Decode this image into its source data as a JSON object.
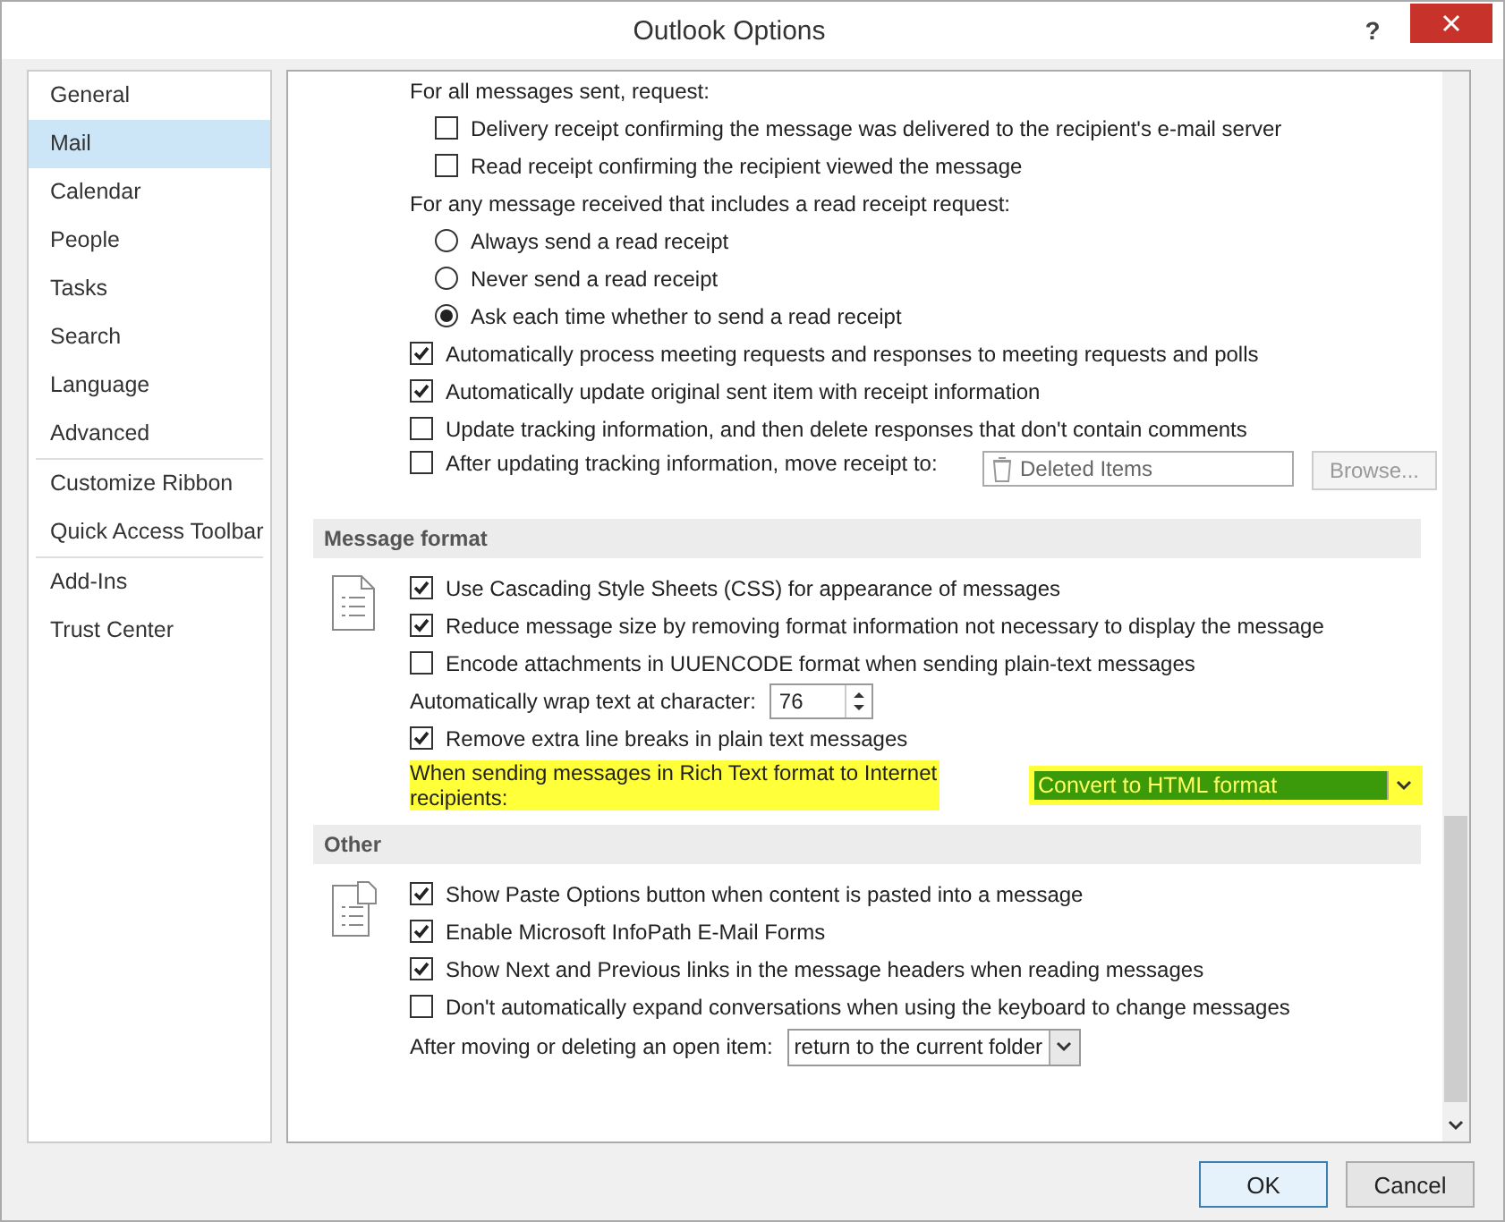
{
  "window": {
    "title": "Outlook Options",
    "help": "?"
  },
  "sidebar": {
    "groups": [
      {
        "items": [
          {
            "label": "General",
            "selected": false
          },
          {
            "label": "Mail",
            "selected": true
          },
          {
            "label": "Calendar",
            "selected": false
          },
          {
            "label": "People",
            "selected": false
          },
          {
            "label": "Tasks",
            "selected": false
          },
          {
            "label": "Search",
            "selected": false
          },
          {
            "label": "Language",
            "selected": false
          },
          {
            "label": "Advanced",
            "selected": false
          }
        ]
      },
      {
        "items": [
          {
            "label": "Customize Ribbon",
            "selected": false
          },
          {
            "label": "Quick Access Toolbar",
            "selected": false
          }
        ]
      },
      {
        "items": [
          {
            "label": "Add-Ins",
            "selected": false
          },
          {
            "label": "Trust Center",
            "selected": false
          }
        ]
      }
    ]
  },
  "sections": [
    {
      "rows": [
        {
          "kind": "label",
          "text": "For all messages sent, request:",
          "children": [
            {
              "kind": "checkbox",
              "text": "Delivery receipt confirming the message was delivered to the recipient's e-mail server",
              "checked": false
            },
            {
              "kind": "checkbox",
              "text": "Read receipt confirming the recipient viewed the message",
              "checked": false
            }
          ]
        },
        {
          "kind": "label",
          "text": "For any message received that includes a read receipt request:",
          "children": [
            {
              "kind": "radio",
              "text": "Always send a read receipt",
              "selected": false
            },
            {
              "kind": "radio",
              "text": "Never send a read receipt",
              "selected": false
            },
            {
              "kind": "radio",
              "text": "Ask each time whether to send a read receipt",
              "selected": true
            }
          ]
        },
        {
          "kind": "checkbox",
          "text": "Automatically process meeting requests and responses to meeting requests and polls",
          "checked": true
        },
        {
          "kind": "checkbox",
          "text": "Automatically update original sent item with receipt information",
          "checked": true
        },
        {
          "kind": "checkbox",
          "text": "Update tracking information, and then delete responses that don't contain comments",
          "checked": false
        },
        {
          "kind": "folder",
          "text": "After updating tracking information, move receipt to:",
          "checked": false,
          "folder": "Deleted Items",
          "button": "Browse...",
          "disabled": true
        }
      ]
    },
    {
      "title": "Message format",
      "rows": [
        {
          "kind": "checkbox",
          "text": "Use Cascading Style Sheets (CSS) for appearance of messages",
          "checked": true
        },
        {
          "kind": "checkbox",
          "text": "Reduce message size by removing format information not necessary to display the message",
          "checked": true
        },
        {
          "kind": "checkbox",
          "text": "Encode attachments in UUENCODE format when sending plain-text messages",
          "checked": false
        },
        {
          "kind": "spinner",
          "text": "Automatically wrap text at character:",
          "value": "76"
        },
        {
          "kind": "checkbox",
          "text": "Remove extra line breaks in plain text messages",
          "checked": true
        },
        {
          "kind": "dropdown",
          "text": "When sending messages in Rich Text format to Internet recipients:",
          "value": "Convert to HTML format",
          "highlighted": true
        }
      ]
    },
    {
      "title": "Other",
      "rows": [
        {
          "kind": "checkbox",
          "text": "Show Paste Options button when content is pasted into a message",
          "checked": true
        },
        {
          "kind": "checkbox",
          "text": "Enable Microsoft InfoPath E-Mail Forms",
          "checked": true
        },
        {
          "kind": "checkbox",
          "text": "Show Next and Previous links in the message headers when reading messages",
          "checked": true
        },
        {
          "kind": "checkbox",
          "text": "Don't automatically expand conversations when using the keyboard to change messages",
          "checked": false
        },
        {
          "kind": "dropdown",
          "text": "After moving or deleting an open item:",
          "value": "return to the current folder",
          "highlighted": false
        }
      ]
    }
  ],
  "buttons": [
    {
      "label": "OK",
      "default": true
    },
    {
      "label": "Cancel",
      "default": false
    }
  ]
}
